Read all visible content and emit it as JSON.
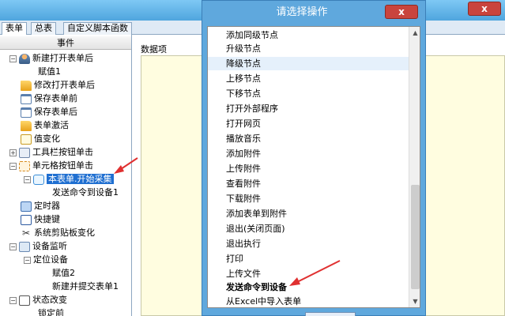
{
  "main_window": {
    "close_symbol": "x",
    "tabs": [
      {
        "label": "表单"
      },
      {
        "label": "总表"
      },
      {
        "label": "自定义脚本函数"
      }
    ]
  },
  "tree": {
    "header": "事件",
    "nodes": [
      {
        "label": "新建打开表单后",
        "toggle": "−",
        "icon": "user-icon"
      },
      {
        "label": "赋值1"
      },
      {
        "label": "修改打开表单后",
        "icon": "folder-icon"
      },
      {
        "label": "保存表单前",
        "icon": "document-icon"
      },
      {
        "label": "保存表单后",
        "icon": "document-icon"
      },
      {
        "label": "表单激活",
        "icon": "folder-icon"
      },
      {
        "label": "值变化",
        "icon": "edit-icon"
      },
      {
        "label": "工具栏按钮单击",
        "toggle": "+",
        "icon": "toolbar-icon"
      },
      {
        "label": "单元格按钮单击",
        "toggle": "−",
        "icon": "cell-icon"
      },
      {
        "label": "本表单.开始采集",
        "toggle": "−",
        "icon": "bubble-icon",
        "selected": true
      },
      {
        "label": "发送命令到设备1"
      },
      {
        "label": "定时器",
        "icon": "timer-icon"
      },
      {
        "label": "快捷键",
        "icon": "shortcut-icon"
      },
      {
        "label": "系统剪贴板变化",
        "icon": "scissors-icon"
      },
      {
        "label": "设备监听",
        "toggle": "−",
        "icon": "monitor-icon"
      },
      {
        "label": "定位设备",
        "toggle": "−"
      },
      {
        "label": "赋值2"
      },
      {
        "label": "新建并提交表单1"
      },
      {
        "label": "状态改变",
        "toggle": "−",
        "icon": "status-icon"
      },
      {
        "label": "锁定前"
      }
    ]
  },
  "data_panel": {
    "label": "数据项"
  },
  "dialog": {
    "title": "请选择操作",
    "close_symbol": "x",
    "items": [
      {
        "label": "添加同级节点"
      },
      {
        "label": "升级节点"
      },
      {
        "label": "降级节点",
        "hover": true
      },
      {
        "label": "上移节点"
      },
      {
        "label": "下移节点"
      },
      {
        "label": "打开外部程序"
      },
      {
        "label": "打开网页"
      },
      {
        "label": "播放音乐"
      },
      {
        "label": "添加附件"
      },
      {
        "label": "上传附件"
      },
      {
        "label": "查看附件"
      },
      {
        "label": "下载附件"
      },
      {
        "label": "添加表单到附件"
      },
      {
        "label": "退出(关闭页面)"
      },
      {
        "label": "退出执行"
      },
      {
        "label": "打印"
      },
      {
        "label": "上传文件"
      },
      {
        "label": "发送命令到设备",
        "bold": true
      },
      {
        "label": "从Excel中导入表单"
      }
    ],
    "scroll_up_symbol": "▲",
    "scroll_down_symbol": "▼"
  },
  "colors": {
    "titlebar": "#5fa8dd",
    "close_button": "#c9443d",
    "selection": "#1f6fd1",
    "annotation_arrow": "#e03030",
    "data_area": "#fffde0"
  }
}
